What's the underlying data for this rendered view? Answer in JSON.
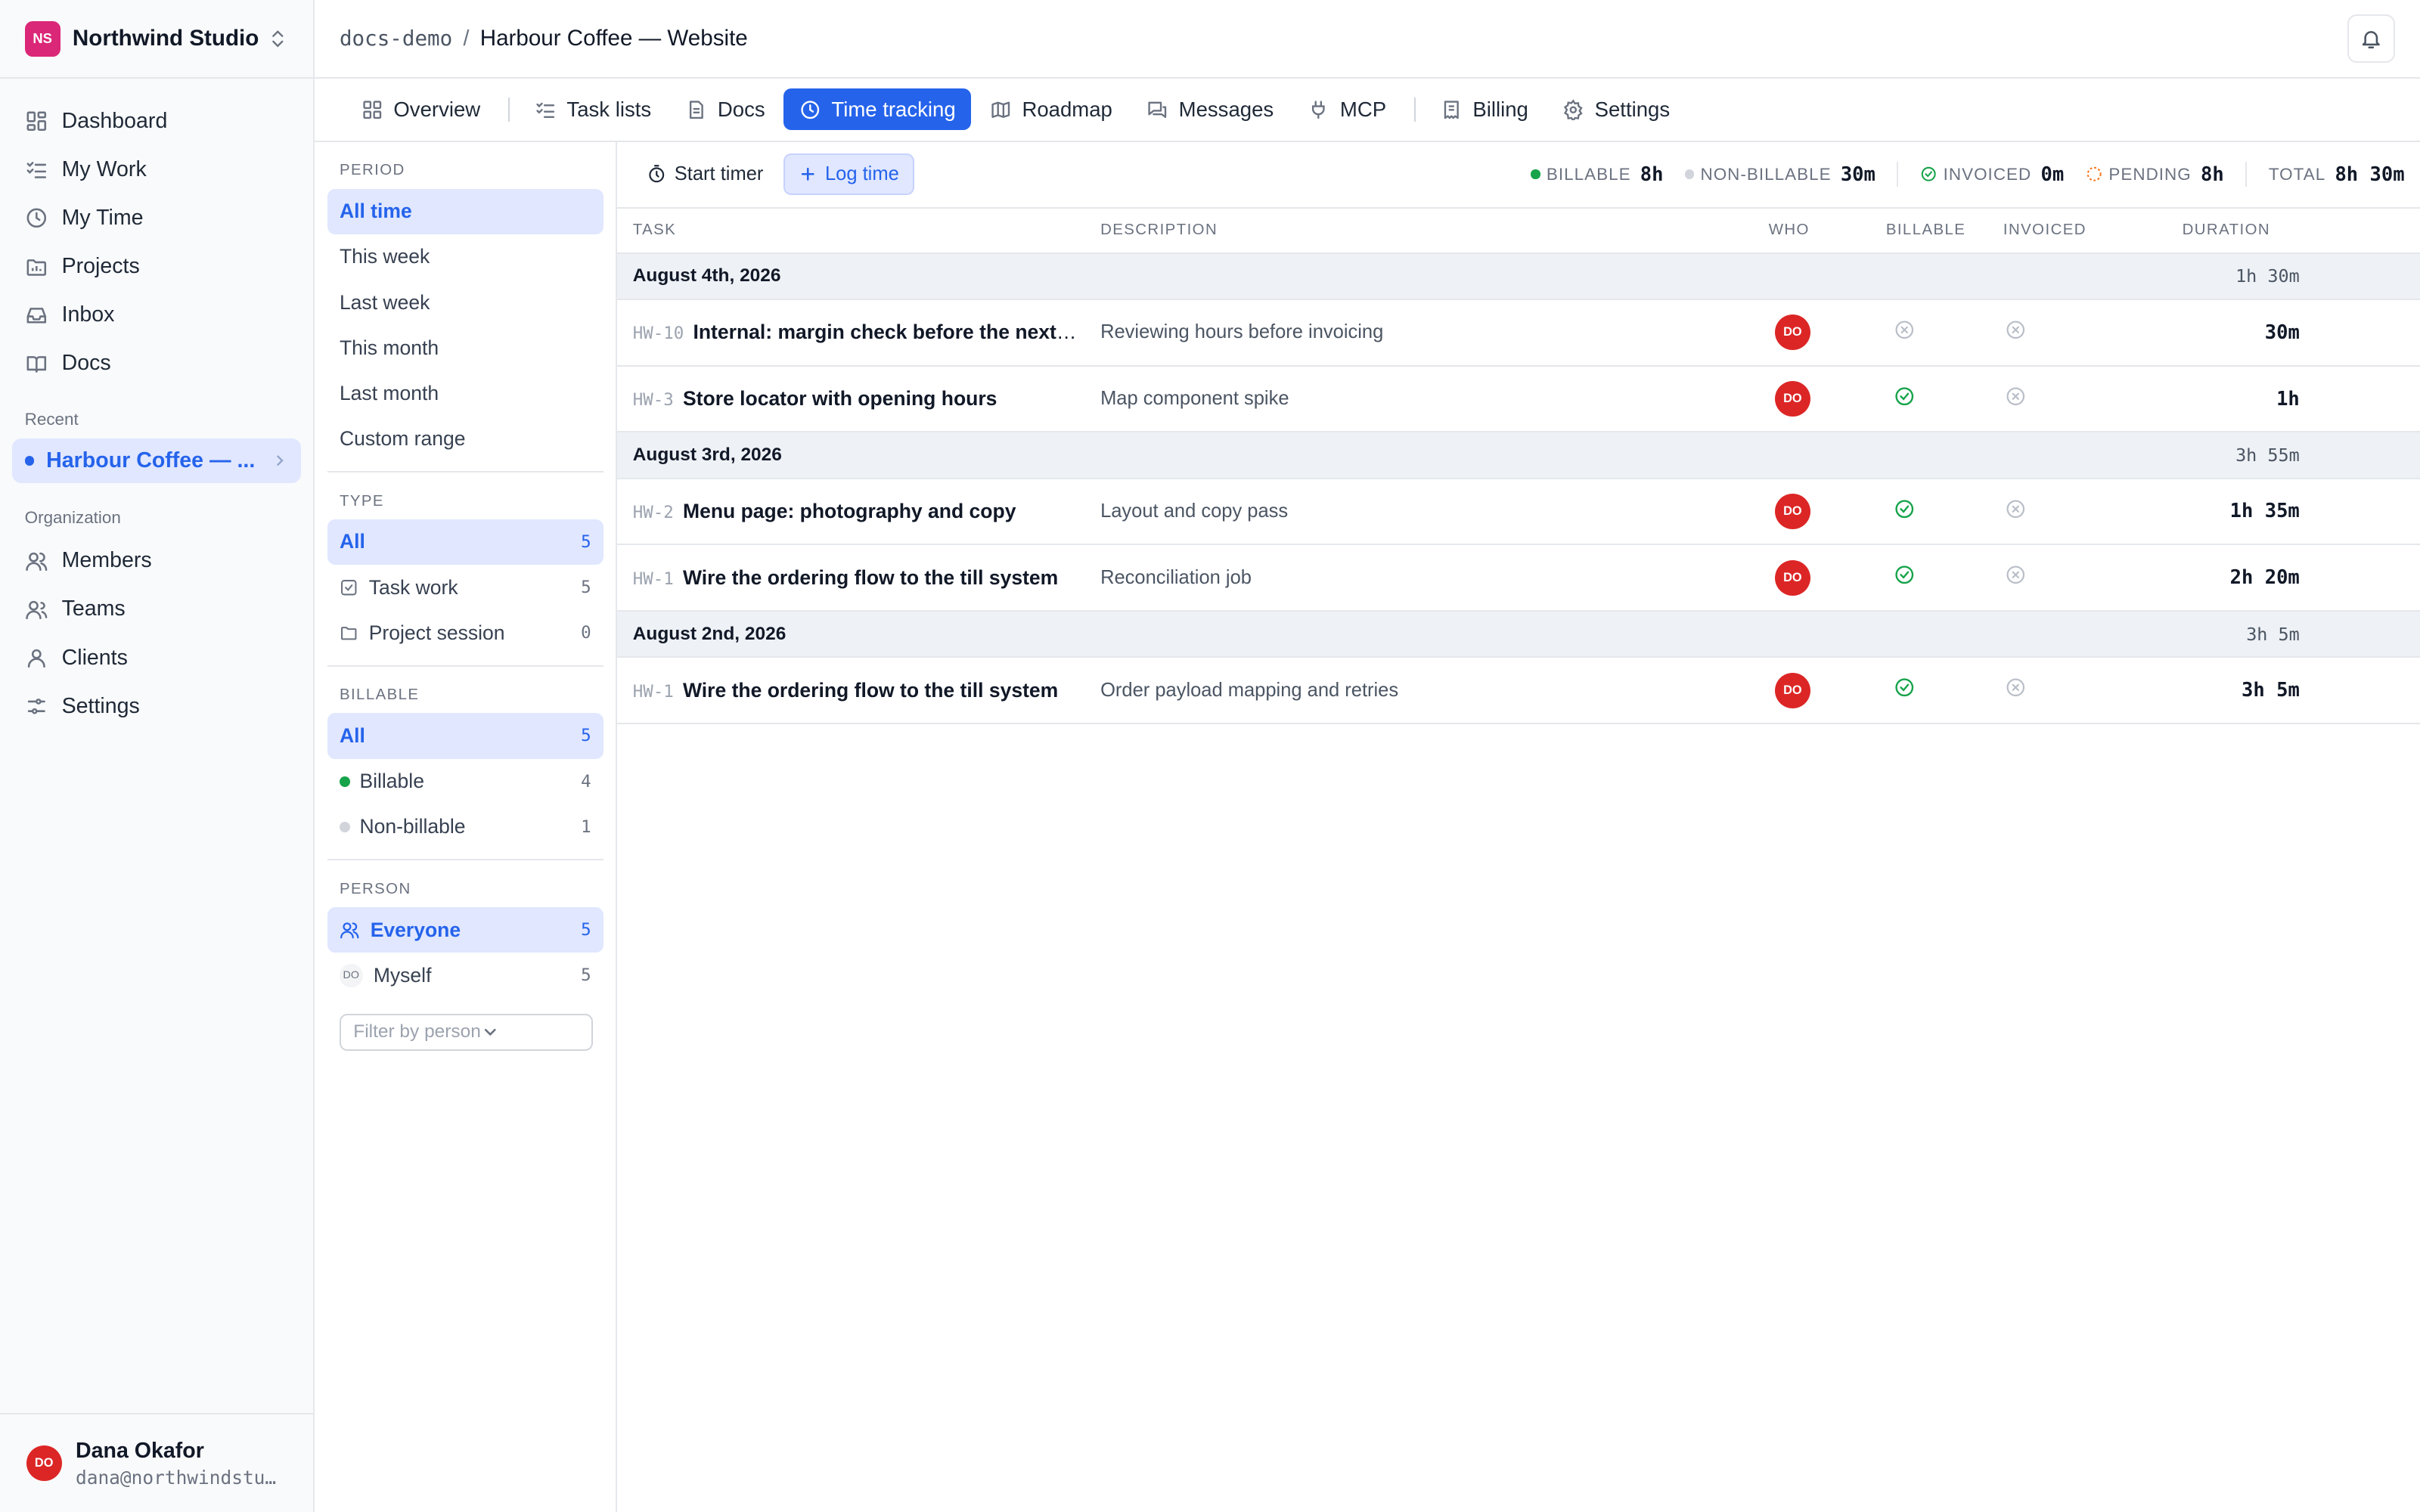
{
  "workspace": {
    "initials": "NS",
    "name": "Northwind Studio"
  },
  "nav": [
    {
      "label": "Dashboard",
      "icon": "dashboard-icon"
    },
    {
      "label": "My Work",
      "icon": "checklist-icon"
    },
    {
      "label": "My Time",
      "icon": "clock-icon"
    },
    {
      "label": "Projects",
      "icon": "folder-chart-icon"
    },
    {
      "label": "Inbox",
      "icon": "inbox-icon"
    },
    {
      "label": "Docs",
      "icon": "book-icon"
    }
  ],
  "recent": {
    "label": "Recent",
    "item": "Harbour Coffee — ..."
  },
  "org": {
    "label": "Organization",
    "items": [
      {
        "label": "Members",
        "icon": "users-icon"
      },
      {
        "label": "Teams",
        "icon": "team-icon"
      },
      {
        "label": "Clients",
        "icon": "client-icon"
      },
      {
        "label": "Settings",
        "icon": "sliders-icon"
      }
    ]
  },
  "user": {
    "initials": "DO",
    "name": "Dana Okafor",
    "email": "dana@northwindstud…"
  },
  "breadcrumb": {
    "workspace": "docs-demo",
    "separator": "/",
    "title": "Harbour Coffee — Website"
  },
  "tabs": [
    {
      "label": "Overview",
      "icon": "grid-icon"
    },
    {
      "label": "Task lists",
      "icon": "list-check-icon"
    },
    {
      "label": "Docs",
      "icon": "document-icon"
    },
    {
      "label": "Time tracking",
      "icon": "clock-icon",
      "active": true
    },
    {
      "label": "Roadmap",
      "icon": "map-icon"
    },
    {
      "label": "Messages",
      "icon": "chat-icon"
    },
    {
      "label": "MCP",
      "icon": "plug-icon"
    },
    {
      "label": "Billing",
      "icon": "receipt-icon"
    },
    {
      "label": "Settings",
      "icon": "gear-icon"
    }
  ],
  "filters": {
    "period": {
      "title": "PERIOD",
      "items": [
        "All time",
        "This week",
        "Last week",
        "This month",
        "Last month",
        "Custom range"
      ]
    },
    "type": {
      "title": "TYPE",
      "items": [
        {
          "label": "All",
          "count": "5"
        },
        {
          "label": "Task work",
          "count": "5"
        },
        {
          "label": "Project session",
          "count": "0"
        }
      ]
    },
    "billable": {
      "title": "BILLABLE",
      "items": [
        {
          "label": "All",
          "count": "5"
        },
        {
          "label": "Billable",
          "count": "4"
        },
        {
          "label": "Non-billable",
          "count": "1"
        }
      ]
    },
    "person": {
      "title": "PERSON",
      "items": [
        {
          "label": "Everyone",
          "count": "5"
        },
        {
          "label": "Myself",
          "count": "5",
          "initials": "DO"
        }
      ],
      "placeholder": "Filter by person"
    }
  },
  "toolbar": {
    "start_timer": "Start timer",
    "log_time": "Log time"
  },
  "stats": {
    "billable_label": "BILLABLE",
    "billable_value": "8h",
    "non_billable_label": "NON-BILLABLE",
    "non_billable_value": "30m",
    "invoiced_label": "INVOICED",
    "invoiced_value": "0m",
    "pending_label": "PENDING",
    "pending_value": "8h",
    "total_label": "TOTAL",
    "total_value": "8h 30m"
  },
  "columns": {
    "task": "TASK",
    "description": "DESCRIPTION",
    "who": "WHO",
    "billable": "BILLABLE",
    "invoiced": "INVOICED",
    "duration": "DURATION"
  },
  "groups": [
    {
      "date": "August 4th, 2026",
      "total": "1h 30m",
      "entries": [
        {
          "key": "HW-10",
          "task": "Internal: margin check before the next invoice",
          "description": "Reviewing hours before invoicing",
          "who": "DO",
          "billable": false,
          "invoiced": false,
          "duration": "30m"
        },
        {
          "key": "HW-3",
          "task": "Store locator with opening hours",
          "description": "Map component spike",
          "who": "DO",
          "billable": true,
          "invoiced": false,
          "duration": "1h"
        }
      ]
    },
    {
      "date": "August 3rd, 2026",
      "total": "3h 55m",
      "entries": [
        {
          "key": "HW-2",
          "task": "Menu page: photography and copy",
          "description": "Layout and copy pass",
          "who": "DO",
          "billable": true,
          "invoiced": false,
          "duration": "1h 35m"
        },
        {
          "key": "HW-1",
          "task": "Wire the ordering flow to the till system",
          "description": "Reconciliation job",
          "who": "DO",
          "billable": true,
          "invoiced": false,
          "duration": "2h 20m"
        }
      ]
    },
    {
      "date": "August 2nd, 2026",
      "total": "3h 5m",
      "entries": [
        {
          "key": "HW-1",
          "task": "Wire the ordering flow to the till system",
          "description": "Order payload mapping and retries",
          "who": "DO",
          "billable": true,
          "invoiced": false,
          "duration": "3h 5m"
        }
      ]
    }
  ],
  "colors": {
    "accent": "#2563eb",
    "brand": "#db2777",
    "avatar": "#dc2626",
    "ok": "#16a34a",
    "pending": "#f97316"
  }
}
